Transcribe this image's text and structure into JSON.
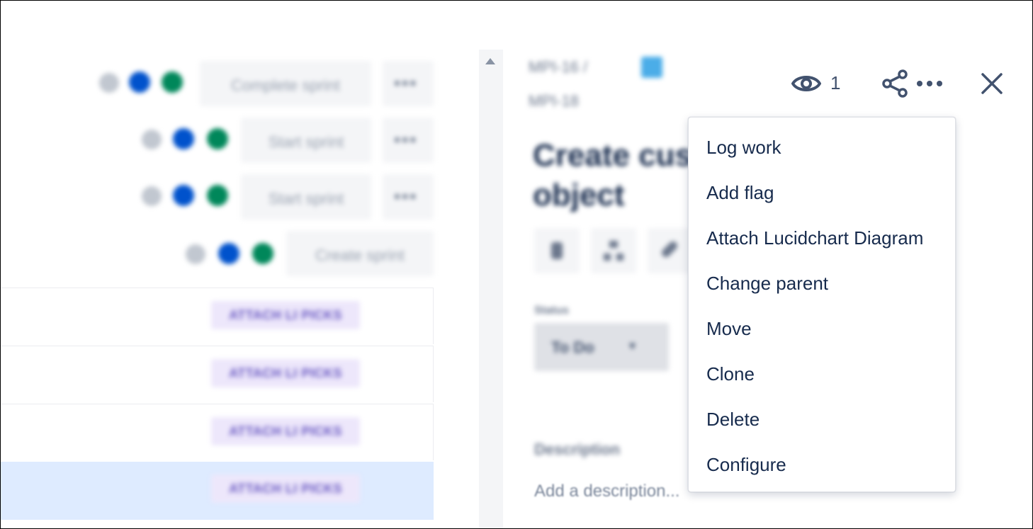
{
  "sprint_rows": [
    {
      "button_label": "Complete sprint",
      "more_label": "•••"
    },
    {
      "button_label": "Start sprint",
      "more_label": "•••"
    },
    {
      "button_label": "Start sprint",
      "more_label": "•••"
    },
    {
      "button_label": "Create sprint"
    }
  ],
  "issue_rows": [
    {
      "status": "ATTACH LI PICKS"
    },
    {
      "status": "ATTACH LI PICKS"
    },
    {
      "status": "ATTACH LI PICKS"
    },
    {
      "status": "ATTACH LI PICKS"
    }
  ],
  "detail": {
    "breadcrumb_parent": "MPI-16 /",
    "breadcrumb_key": "MPI-18",
    "title_line1": "Create cus",
    "title_line2": "object",
    "status_label": "Status",
    "status_value": "To Do",
    "description_label": "Description",
    "description_placeholder": "Add a description..."
  },
  "header": {
    "watch_count": "1"
  },
  "menu": {
    "items": [
      {
        "label": "Log work"
      },
      {
        "label": "Add flag"
      },
      {
        "label": "Attach Lucidchart Diagram"
      },
      {
        "label": "Change parent"
      },
      {
        "label": "Move"
      },
      {
        "label": "Clone"
      },
      {
        "label": "Delete"
      },
      {
        "label": "Configure"
      }
    ]
  },
  "colors": {
    "avatar_blue": "#0052cc",
    "avatar_green": "#00875a",
    "selected_row": "#deebff",
    "lozenge_bg": "#ede7fb",
    "text_primary": "#172b4d"
  },
  "icons": [
    "eye-icon",
    "share-icon",
    "more-icon",
    "close-icon",
    "attachment-icon",
    "child-issue-icon",
    "link-icon",
    "chevron-down-icon",
    "scroll-up-icon"
  ]
}
